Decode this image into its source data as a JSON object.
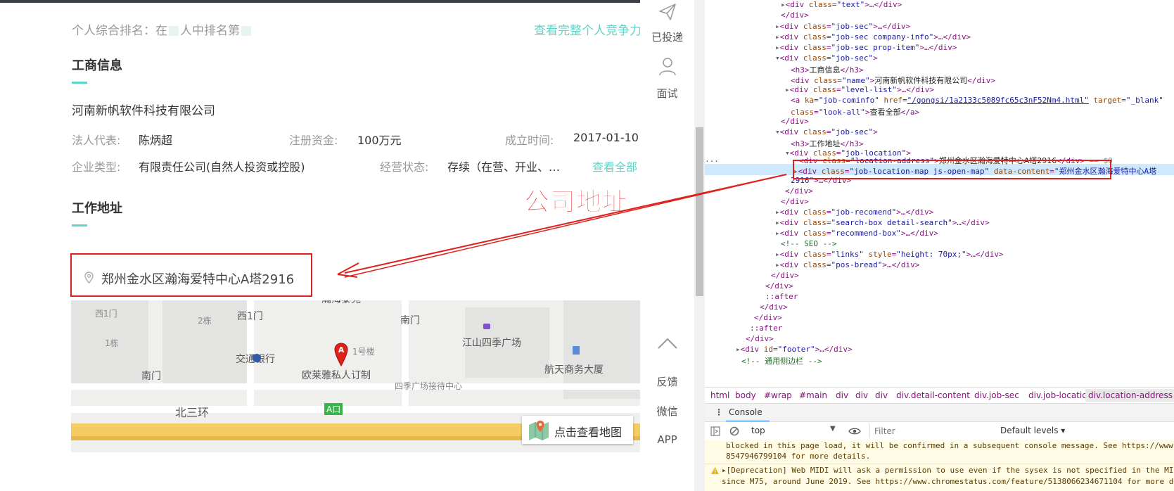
{
  "left_page": {
    "rank_prefix": "个人综合排名：在",
    "rank_mid": "人中排名第",
    "rank_link": "查看完整个人竞争力",
    "biz_heading": "工商信息",
    "company_name": "河南新帆软件科技有限公司",
    "legal_rep_label": "法人代表:",
    "legal_rep_value": "陈炳超",
    "capital_label": "注册资金:",
    "capital_value": "100万元",
    "founded_label": "成立时间:",
    "founded_value": "2017-01-10",
    "type_label": "企业类型:",
    "type_value": "有限责任公司(自然人投资或控股)",
    "status_label": "经营状态:",
    "status_value": "存续（在营、开业、…",
    "look_all": "查看全部",
    "work_heading": "工作地址",
    "address": "郑州金水区瀚海爱特中心A塔2916",
    "annotation": "公司地址",
    "map": {
      "button_label": "点击查看地图",
      "labels": [
        "西1门",
        "2栋",
        "西1门",
        "瀚海泰苑",
        "南门",
        "1栋",
        "交通银行",
        "欧莱雅私人订制",
        "江山四季广场",
        "四季广场接待中心",
        "航天商务大厦",
        "南门",
        "北三环",
        "A口",
        "1号楼"
      ],
      "marker": "A"
    }
  },
  "side_rail": {
    "items": [
      "已投递",
      "面试",
      "反馈",
      "微信",
      "APP"
    ]
  },
  "devtools": {
    "breadcrumbs": [
      "html",
      "body",
      "#wrap",
      "#main",
      "div",
      "div",
      "div",
      "div.detail-content",
      "div.job-sec",
      "div.job-location",
      "div.location-address"
    ],
    "console_tab": "Console",
    "context": "top",
    "filter_placeholder": "Filter",
    "levels": "Default levels ▾",
    "msg1_a": "blocked in this page load, it will be confirmed in a subsequent console message. See https://www.",
    "msg1_b": "8547946799104 for more details.",
    "msg2_a": "▸[Deprecation] Web MIDI will ask a permission to use even if the sysex is not specified in the MI",
    "msg2_b": "since M75, around June 2019. See https://www.chromestatus.com/feature/5138066234671104 for more d"
  }
}
